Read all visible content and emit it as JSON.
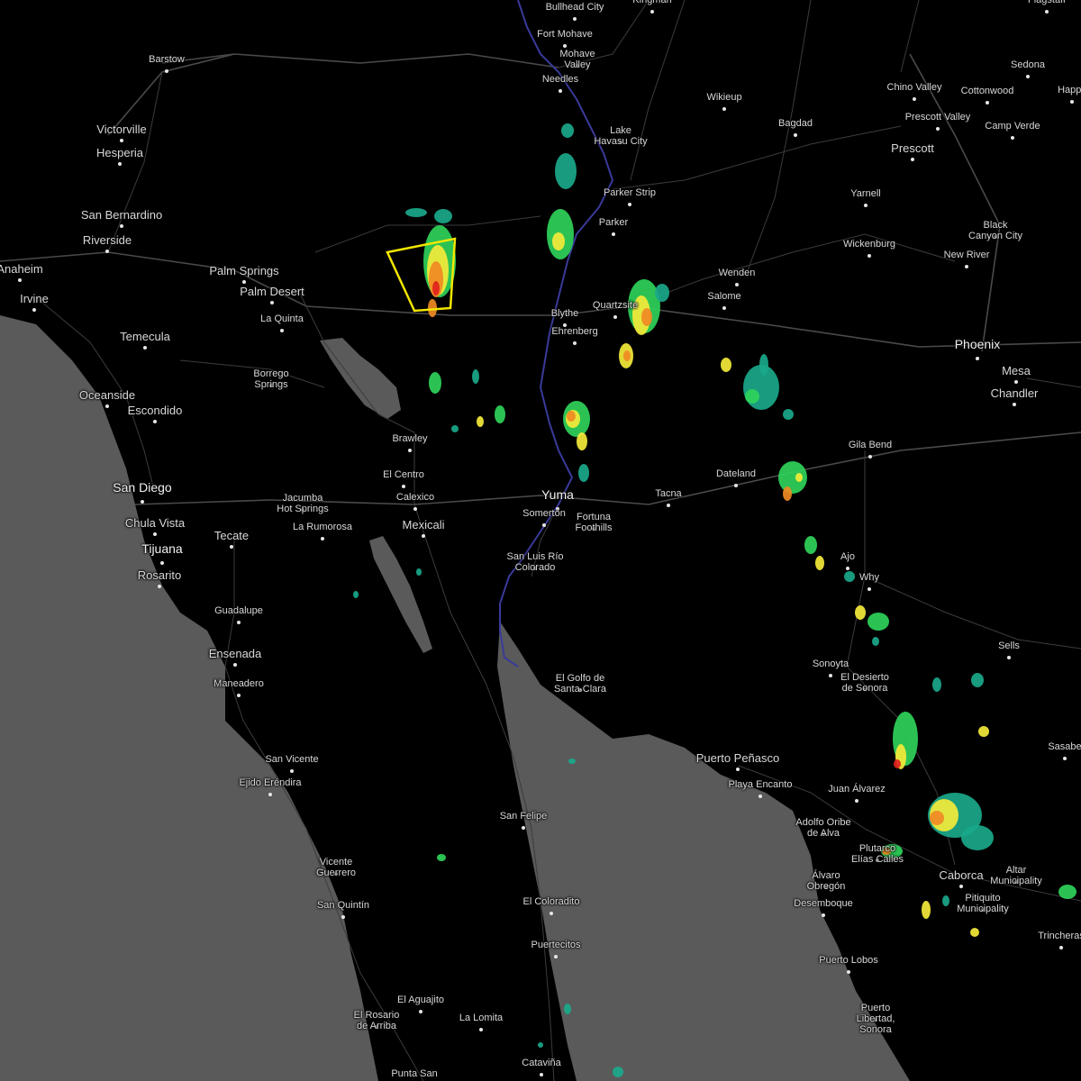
{
  "map": {
    "colors": {
      "land": "#000000",
      "water": "#5a5a5a",
      "roads": "#3c3c3c",
      "highways": "#4a4a4a",
      "river": "#3a3a9a",
      "warning_box": "#f2e600",
      "radar_light": "#1aa88a",
      "radar_mid": "#2fd35a",
      "radar_yellow": "#f4ea3a",
      "radar_orange": "#f08a24",
      "radar_red": "#e0221c"
    },
    "cities": [
      {
        "name": "Bullhead City"
      },
      {
        "name": "Fort Mohave"
      },
      {
        "name": "Mohave\nValley"
      },
      {
        "name": "Needles"
      },
      {
        "name": "Barstow"
      },
      {
        "name": "Victorville"
      },
      {
        "name": "Hesperia"
      },
      {
        "name": "San Bernardino"
      },
      {
        "name": "Riverside"
      },
      {
        "name": "Anaheim"
      },
      {
        "name": "Irvine"
      },
      {
        "name": "Palm Springs"
      },
      {
        "name": "Palm Desert"
      },
      {
        "name": "La Quinta"
      },
      {
        "name": "Temecula"
      },
      {
        "name": "Borrego\nSprings"
      },
      {
        "name": "Oceanside"
      },
      {
        "name": "Escondido"
      },
      {
        "name": "San Diego"
      },
      {
        "name": "Chula Vista"
      },
      {
        "name": "Tijuana"
      },
      {
        "name": "Rosarito"
      },
      {
        "name": "Tecate"
      },
      {
        "name": "Jacumba\nHot Springs"
      },
      {
        "name": "La Rumorosa"
      },
      {
        "name": "Mexicali"
      },
      {
        "name": "Calexico"
      },
      {
        "name": "El Centro"
      },
      {
        "name": "Brawley"
      },
      {
        "name": "Lake\nHavasu City"
      },
      {
        "name": "Parker Strip"
      },
      {
        "name": "Parker"
      },
      {
        "name": "Blythe"
      },
      {
        "name": "Ehrenberg"
      },
      {
        "name": "Quartzsite"
      },
      {
        "name": "Wikieup"
      },
      {
        "name": "Bagdad"
      },
      {
        "name": "Chino Valley"
      },
      {
        "name": "Cottonwood"
      },
      {
        "name": "Sedona"
      },
      {
        "name": "Prescott Valley"
      },
      {
        "name": "Camp Verde"
      },
      {
        "name": "Prescott"
      },
      {
        "name": "Yarnell"
      },
      {
        "name": "Black\nCanyon City"
      },
      {
        "name": "Wickenburg"
      },
      {
        "name": "New River"
      },
      {
        "name": "Wenden"
      },
      {
        "name": "Salome"
      },
      {
        "name": "Phoenix"
      },
      {
        "name": "Mesa"
      },
      {
        "name": "Chandler"
      },
      {
        "name": "Gila Bend"
      },
      {
        "name": "Dateland"
      },
      {
        "name": "Tacna"
      },
      {
        "name": "Yuma"
      },
      {
        "name": "Somerton"
      },
      {
        "name": "Fortuna\nFoothills"
      },
      {
        "name": "San Luis Río\nColorado"
      },
      {
        "name": "Ajo"
      },
      {
        "name": "Why"
      },
      {
        "name": "Sells"
      },
      {
        "name": "Sonoyta"
      },
      {
        "name": "El Desierto\nde Sonora"
      },
      {
        "name": "El Golfo de\nSanta Clara"
      },
      {
        "name": "Puerto Peñasco"
      },
      {
        "name": "Playa Encanto"
      },
      {
        "name": "Juan Álvarez"
      },
      {
        "name": "Adolfo Oribe\nde Alva"
      },
      {
        "name": "Plutarco\nElías Calles"
      },
      {
        "name": "Caborca"
      },
      {
        "name": "Altar\nMunicipality"
      },
      {
        "name": "Pitiquito\nMunicipality"
      },
      {
        "name": "Álvaro\nObregón"
      },
      {
        "name": "Desemboque"
      },
      {
        "name": "Puerto Lobos"
      },
      {
        "name": "Puerto\nLibertad,\nSonora"
      },
      {
        "name": "Trincheras"
      },
      {
        "name": "Sasabe"
      },
      {
        "name": "Guadalupe"
      },
      {
        "name": "Ensenada"
      },
      {
        "name": "Maneadero"
      },
      {
        "name": "San Vicente"
      },
      {
        "name": "Ejido Eréndira"
      },
      {
        "name": "Vicente\nGuerrero"
      },
      {
        "name": "San Quintín"
      },
      {
        "name": "San Felipe"
      },
      {
        "name": "El Coloradito"
      },
      {
        "name": "Puertecitos"
      },
      {
        "name": "El Aguajito"
      },
      {
        "name": "El Rosario\nde Arriba"
      },
      {
        "name": "La Lomita"
      },
      {
        "name": "Cataviña"
      },
      {
        "name": "Punta San"
      },
      {
        "name": "Kingman"
      },
      {
        "name": "Flagstaff"
      },
      {
        "name": "Happy"
      }
    ]
  }
}
